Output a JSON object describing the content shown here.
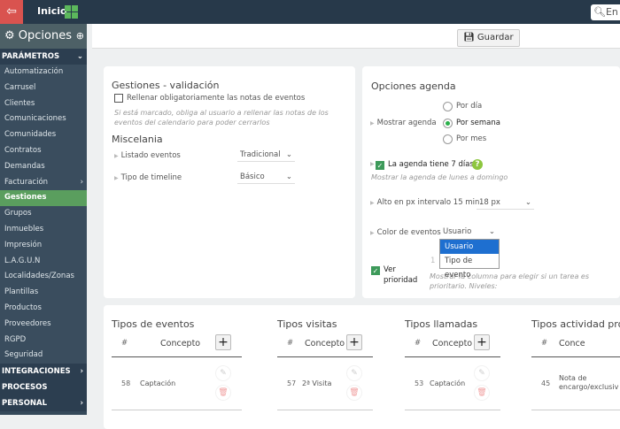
{
  "topbar": {
    "home": "Inicio",
    "search_placeholder": "En"
  },
  "sidebar": {
    "title": "Opciones",
    "sections": [
      {
        "label": "PARÁMETROS",
        "items": [
          "Automatización",
          "Carrusel",
          "Clientes",
          "Comunicaciones",
          "Comunidades",
          "Contratos",
          "Demandas",
          "Facturación",
          "Gestiones",
          "Grupos",
          "Inmuebles",
          "Impresión",
          "L.A.G.U.N",
          "Localidades/Zonas",
          "Plantillas",
          "Productos",
          "Proveedores",
          "RGPD",
          "Seguridad"
        ],
        "active": "Gestiones"
      },
      {
        "label": "INTEGRACIONES"
      },
      {
        "label": "PROCESOS"
      },
      {
        "label": "PERSONAL"
      }
    ]
  },
  "toolbar": {
    "save": "Guardar"
  },
  "validation": {
    "title": "Gestiones - validación",
    "checkbox": "Rellenar obligatoriamente las notas de eventos",
    "checked": false,
    "hint": "Si está marcado, obliga al usuario a rellenar las notas de los eventos del calendario para poder cerrarlos"
  },
  "misc": {
    "title": "Miscelania",
    "listado_label": "Listado eventos",
    "listado_value": "Tradicional",
    "timeline_label": "Tipo de timeline",
    "timeline_value": "Básico"
  },
  "agenda": {
    "title": "Opciones agenda",
    "mostrar_label": "Mostrar agenda",
    "options": [
      "Por día",
      "Por semana",
      "Por mes"
    ],
    "selected": "Por semana",
    "seven_days": "La agenda tiene 7 días",
    "seven_hint": "Mostrar la agenda de lunes a domingo",
    "alto_label": "Alto en px intervalo 15 min.",
    "alto_value": "18 px",
    "color_label": "Color de eventos",
    "color_value": "Usuario",
    "color_options": [
      "Usuario",
      "Tipo de evento"
    ],
    "prioridad_label_1": "Ver",
    "prioridad_label_2": "prioridad",
    "prioridad_value": "1",
    "prioridad_hint": "Mostrar la columna para elegir si un tarea es prioritario. Niveles:"
  },
  "tables": [
    {
      "title": "Tipos de eventos",
      "col1": "#",
      "col2": "Concepto",
      "rows": [
        {
          "id": "58",
          "concepto": "Captación"
        }
      ]
    },
    {
      "title": "Tipos visitas",
      "col1": "#",
      "col2": "Concepto",
      "rows": [
        {
          "id": "57",
          "concepto": "2ª Visita"
        }
      ]
    },
    {
      "title": "Tipos llamadas",
      "col1": "#",
      "col2": "Concepto",
      "rows": [
        {
          "id": "53",
          "concepto": "Captación"
        }
      ]
    },
    {
      "title": "Tipos actividad prop",
      "col1": "#",
      "col2": "Conce",
      "rows": [
        {
          "id": "45",
          "concepto_1": "Nota de",
          "concepto_2": "encargo/exclusiv"
        }
      ]
    }
  ]
}
